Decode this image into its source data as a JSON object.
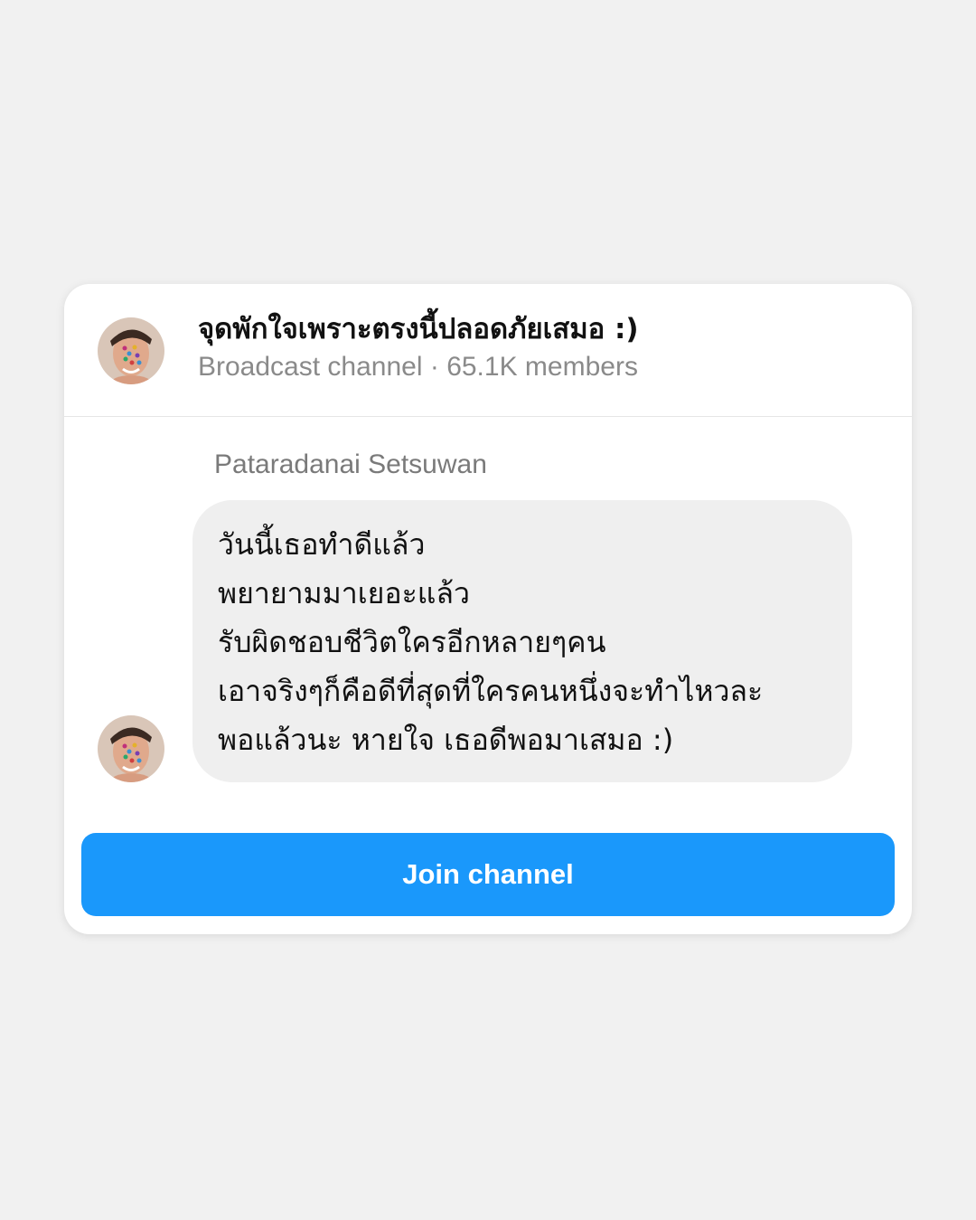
{
  "channel": {
    "title": "จุดพักใจเพราะตรงนี้ปลอดภัยเสมอ :)",
    "type": "Broadcast channel",
    "separator": "·",
    "members": "65.1K members",
    "avatar_icon": "profile-photo-avatar"
  },
  "message": {
    "sender": "Pataradanai Setsuwan",
    "lines": [
      "วันนี้เธอทำดีแล้ว",
      "พยายามมาเยอะแล้ว",
      "รับผิดชอบชีวิตใครอีกหลายๆคน",
      "เอาจริงๆก็คือดีที่สุดที่ใครคนหนึ่งจะทำไหวละ",
      "พอแล้วนะ หายใจ เธอดีพอมาเสมอ :)"
    ]
  },
  "actions": {
    "join_label": "Join channel"
  },
  "colors": {
    "page_background": "#f1f1f1",
    "card_background": "#ffffff",
    "bubble_background": "#efefef",
    "join_button": "#1a98fb",
    "secondary_text": "#8a8a8a"
  }
}
